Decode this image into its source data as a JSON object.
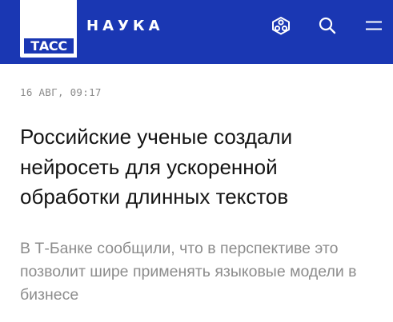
{
  "header": {
    "logo_text": "ТАСС",
    "section": "НАУКА",
    "icons": [
      "share-network-icon",
      "search-icon",
      "menu-icon"
    ],
    "brand_color": "#1a37b3"
  },
  "article": {
    "date": "16 АВГ, 09:17",
    "headline": "Российские ученые создали нейросеть для ускоренной обработки длинных текстов",
    "lead": "В Т-Банке сообщили, что в перспективе это позволит шире применять языковые модели в бизнесе"
  }
}
